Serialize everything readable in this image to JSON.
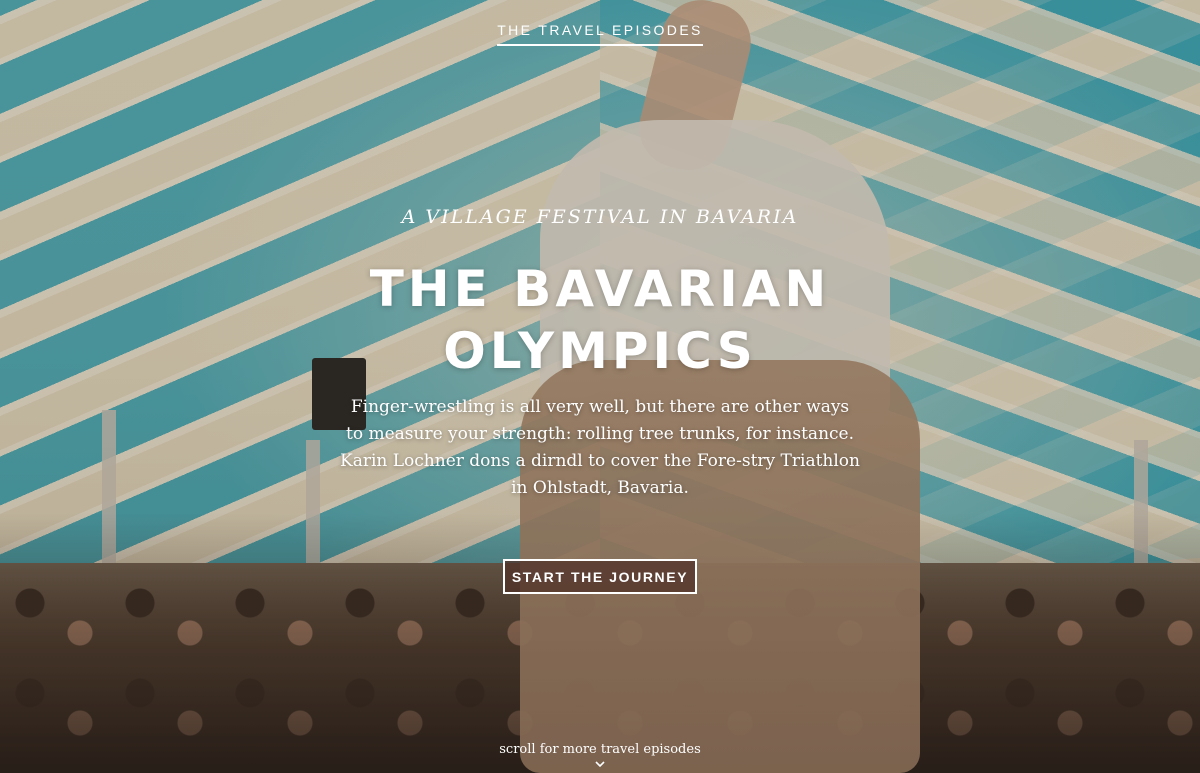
{
  "header": {
    "label": "THE TRAVEL EPISODES"
  },
  "hero": {
    "subtitle": "A VILLAGE FESTIVAL IN BAVARIA",
    "title_line1": "THE BAVARIAN",
    "title_line2": "OLYMPICS",
    "intro": "Finger-wrestling is all very well, but there are other ways to measure your strength: rolling tree trunks, for instance. Karin Lochner dons a dirndl to cover the Fore-stry Triathlon in Ohlstadt, Bavaria.",
    "cta_label": "START THE JOURNEY"
  },
  "footer": {
    "scroll_hint": "scroll for more travel episodes",
    "scroll_icon": "chevron-down-icon"
  },
  "colors": {
    "tent_blue": "#3aa8b8",
    "tent_cream": "#f3ead6",
    "cta_bg": "#503228",
    "text": "#ffffff"
  }
}
